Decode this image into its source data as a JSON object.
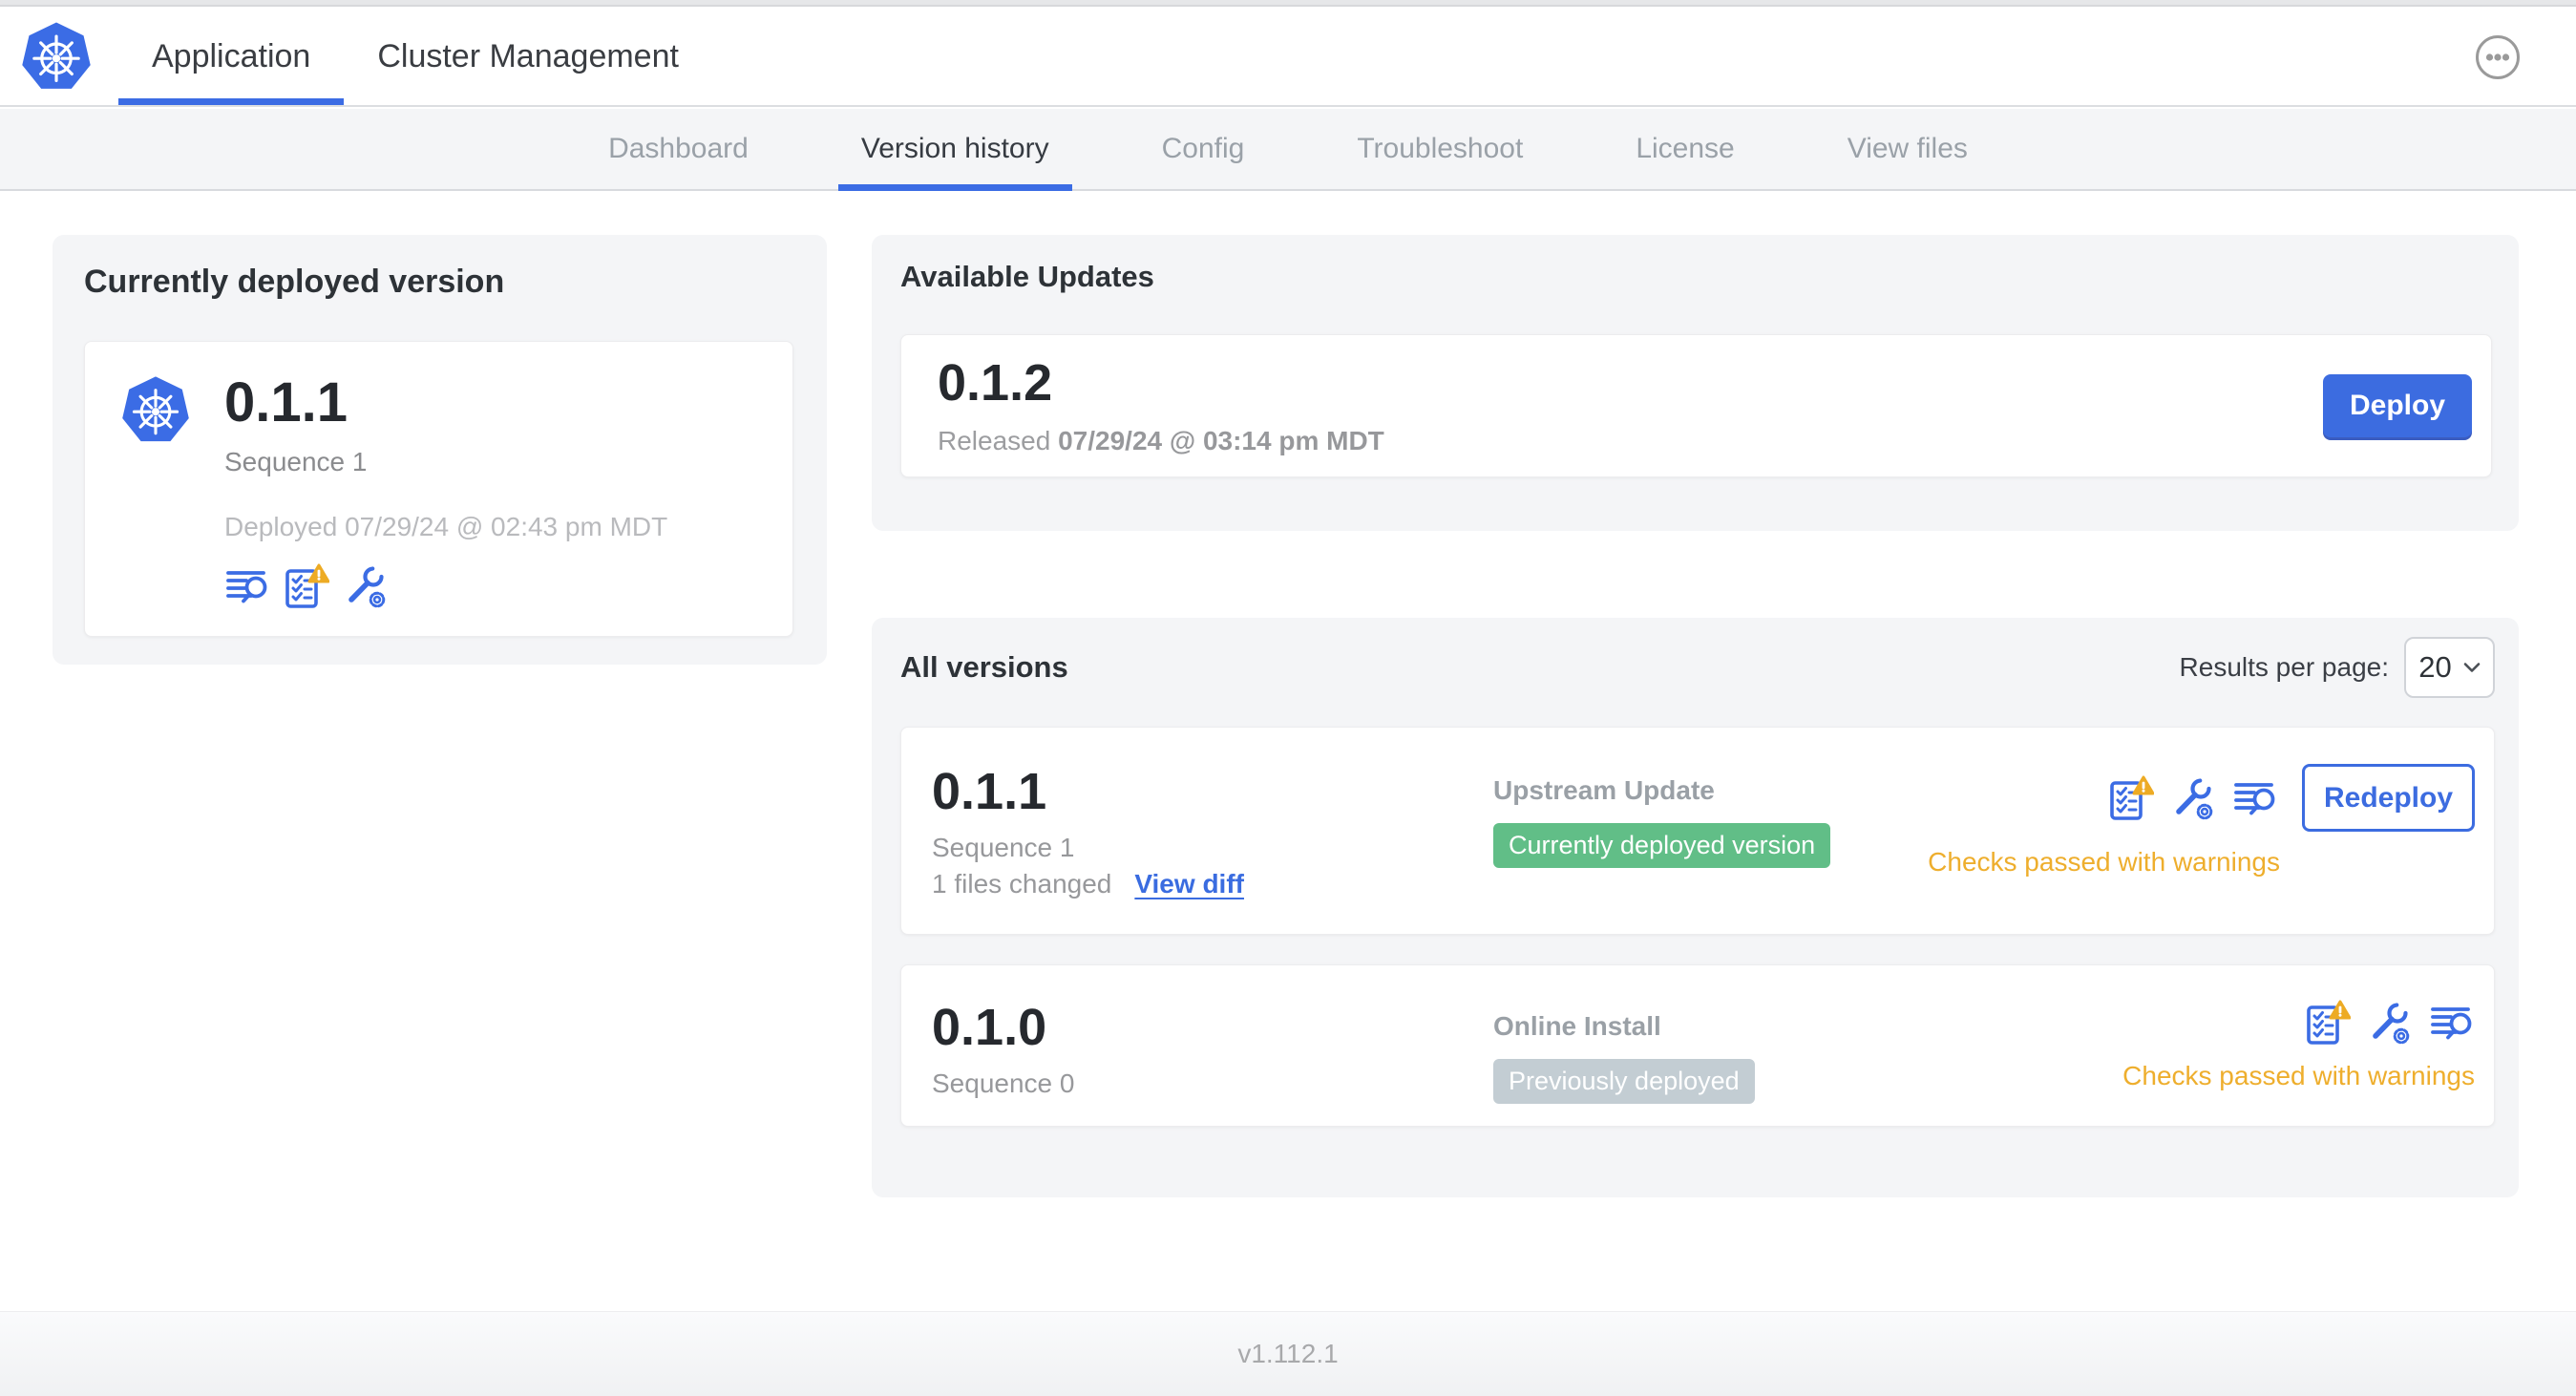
{
  "colors": {
    "accent_blue": "#3b6ce4",
    "kubernetes_blue": "#3b6ce5",
    "badge_green": "#61be87",
    "badge_gray": "#c3cdd3",
    "warning_orange": "#eeae2d",
    "card_gray": "#f4f5f7"
  },
  "header": {
    "tabs": [
      {
        "label": "Application",
        "active": true
      },
      {
        "label": "Cluster Management",
        "active": false
      }
    ]
  },
  "subnav": {
    "tabs": [
      {
        "label": "Dashboard",
        "active": false
      },
      {
        "label": "Version history",
        "active": true
      },
      {
        "label": "Config",
        "active": false
      },
      {
        "label": "Troubleshoot",
        "active": false
      },
      {
        "label": "License",
        "active": false
      },
      {
        "label": "View files",
        "active": false
      }
    ]
  },
  "currently_deployed": {
    "title": "Currently deployed version",
    "version": "0.1.1",
    "sequence": "Sequence 1",
    "deployed_at": "Deployed 07/29/24 @ 02:43 pm MDT",
    "icons": [
      "release-notes-icon",
      "preflight-checks-icon",
      "config-icon"
    ]
  },
  "available_updates": {
    "title": "Available Updates",
    "version": "0.1.2",
    "released_label": "Released",
    "released_at": "07/29/24 @ 03:14 pm MDT",
    "deploy_label": "Deploy"
  },
  "all_versions": {
    "title": "All versions",
    "results_per_page_label": "Results per page:",
    "results_per_page_value": "20",
    "rows": [
      {
        "version": "0.1.1",
        "sequence": "Sequence 1",
        "files_changed": "1 files changed",
        "view_diff_label": "View diff",
        "source": "Upstream Update",
        "badge": "Currently deployed version",
        "badge_color": "#61be87",
        "status": "Checks passed with warnings",
        "action_label": "Redeploy",
        "icons": [
          "preflight-checks-icon",
          "config-icon",
          "release-notes-icon"
        ]
      },
      {
        "version": "0.1.0",
        "sequence": "Sequence 0",
        "source": "Online Install",
        "badge": "Previously deployed",
        "badge_color": "#c3cdd3",
        "status": "Checks passed with warnings",
        "icons": [
          "preflight-checks-icon",
          "config-icon",
          "release-notes-icon"
        ]
      }
    ]
  },
  "footer": {
    "app_version": "v1.112.1"
  }
}
